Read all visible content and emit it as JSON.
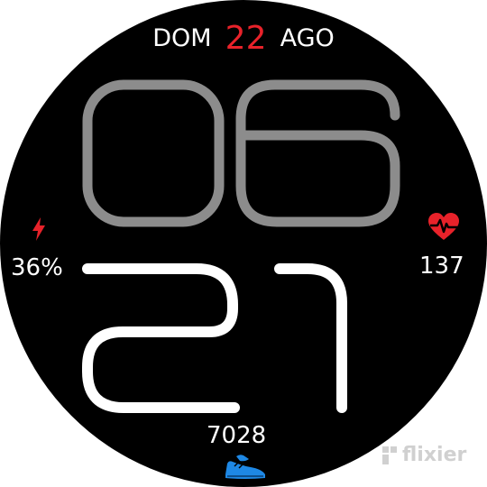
{
  "date": {
    "weekday": "DOM",
    "day": "22",
    "month": "AGO"
  },
  "time": {
    "hours": "06",
    "minutes": "21"
  },
  "battery": {
    "value": "36%",
    "icon": "lightning-bolt-icon"
  },
  "heart_rate": {
    "value": "137",
    "icon": "heart-pulse-icon"
  },
  "steps": {
    "value": "7028",
    "icon": "running-shoe-icon"
  },
  "watermark": {
    "text": "flixier"
  },
  "colors": {
    "face_background": "#000000",
    "accent_red": "#e8222a",
    "hour_gray": "#8c8c8c",
    "minute_white": "#ffffff",
    "shoe_blue": "#1e88e5"
  }
}
